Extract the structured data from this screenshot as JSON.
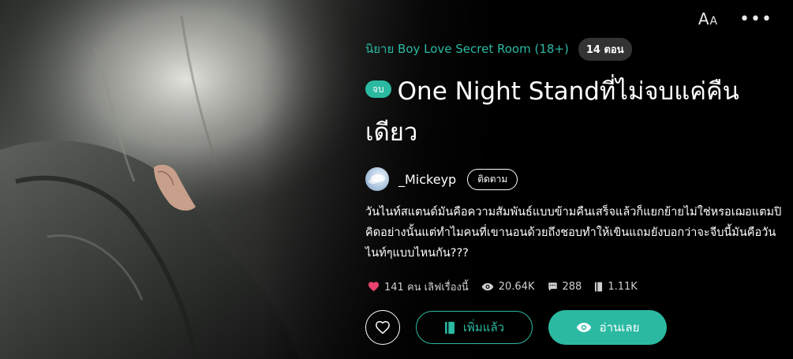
{
  "header": {
    "font_size_icon": "font-size-icon",
    "more_icon": "more-icon"
  },
  "novel": {
    "category": "นิยาย Boy Love Secret Room (18+)",
    "episode_count": "14 ตอน",
    "status_badge": "จบ",
    "title": "One Night Standที่ไม่จบแค่คืนเดียว",
    "author": "_Mickeyp",
    "follow_label": "ติดตาม",
    "synopsis": "วันไนท์สแตนด์มันคือความสัมพันธ์แบบข้ามคืนเสร็จแล้วก็แยกย้ายไม่ใช่หรอเฌอแตมปิคิดอย่างนั้นแต่ทำไมคนที่เขานอนด้วยถึงชอบทำให้เขินแถมยังบอกว่าจะจีบนี้มันคือวันไนท์ๆแบบไหนกัน???"
  },
  "stats": {
    "likes": "141 คน เลิฟเรื่องนี้",
    "views": "20.64K",
    "comments": "288",
    "bookmarks": "1.11K"
  },
  "actions": {
    "added_label": "เพิ่มแล้ว",
    "read_label": "อ่านเลย"
  },
  "colors": {
    "accent": "#2bb9a2",
    "heart": "#e8436c",
    "background": "#000000"
  }
}
